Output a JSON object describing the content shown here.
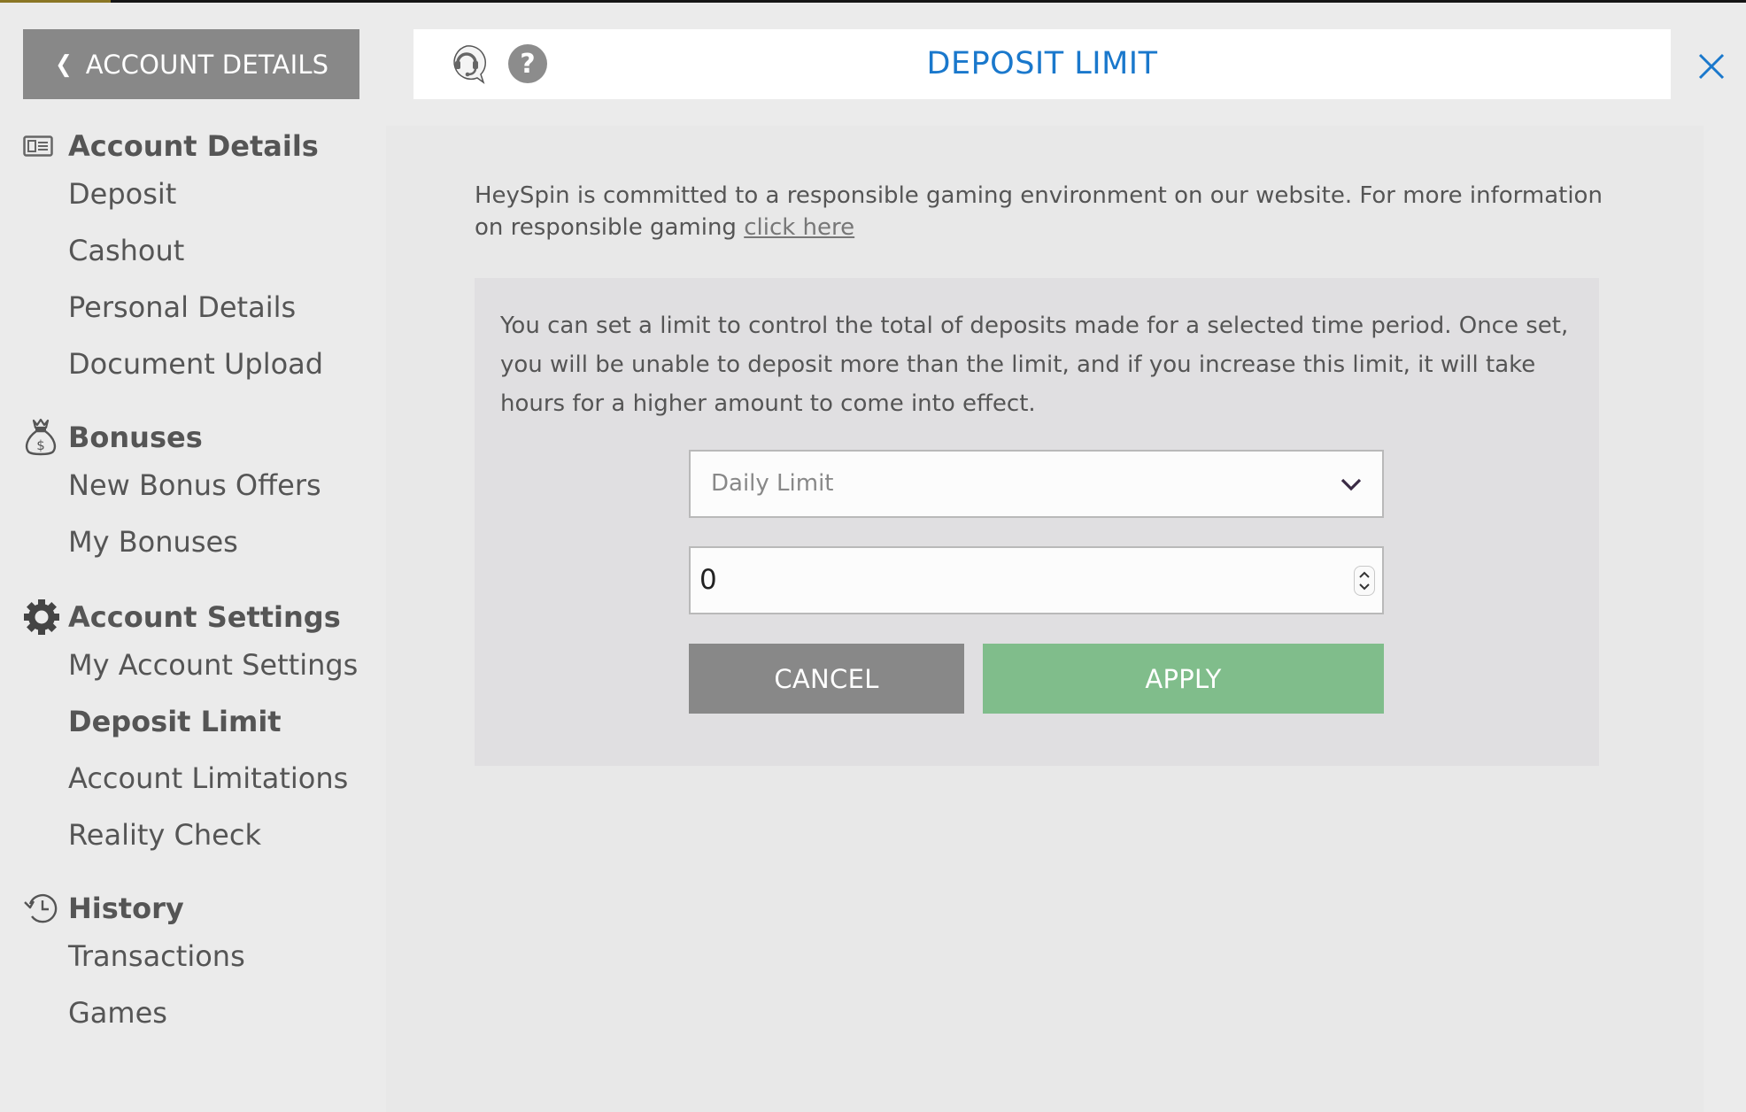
{
  "back_button": {
    "label": "ACCOUNT DETAILS"
  },
  "header": {
    "title": "DEPOSIT LIMIT",
    "icons": [
      "support-headset-icon",
      "help-icon",
      "close-icon"
    ],
    "help_glyph": "?"
  },
  "sidebar": {
    "sections": [
      {
        "label": "Account Details",
        "icon": "id-card-icon",
        "items": [
          {
            "label": "Deposit"
          },
          {
            "label": "Cashout"
          },
          {
            "label": "Personal Details"
          },
          {
            "label": "Document Upload"
          }
        ]
      },
      {
        "label": "Bonuses",
        "icon": "money-bag-icon",
        "items": [
          {
            "label": "New Bonus Offers"
          },
          {
            "label": "My Bonuses"
          }
        ]
      },
      {
        "label": "Account Settings",
        "icon": "gear-icon",
        "items": [
          {
            "label": "My Account Settings"
          },
          {
            "label": "Deposit Limit",
            "active": true
          },
          {
            "label": "Account Limitations"
          },
          {
            "label": "Reality Check"
          }
        ]
      },
      {
        "label": "History",
        "icon": "history-clock-icon",
        "items": [
          {
            "label": "Transactions"
          },
          {
            "label": "Games"
          }
        ]
      }
    ]
  },
  "content": {
    "intro_text": "HeySpin is committed to a responsible gaming environment on our website. For more information on responsible gaming ",
    "intro_link": "click here",
    "description": "You can set a limit to control the total of deposits made for a selected time period. Once set, you will be unable to deposit more than the limit, and if you increase this limit, it will take hours for a higher amount to come into effect.",
    "period_select": {
      "value": "Daily Limit"
    },
    "amount_input": {
      "value": "0"
    },
    "cancel_label": "CANCEL",
    "apply_label": "APPLY"
  },
  "colors": {
    "title_blue": "#1a78cc",
    "apply_green": "#80bd8b",
    "cancel_gray": "#888888"
  }
}
